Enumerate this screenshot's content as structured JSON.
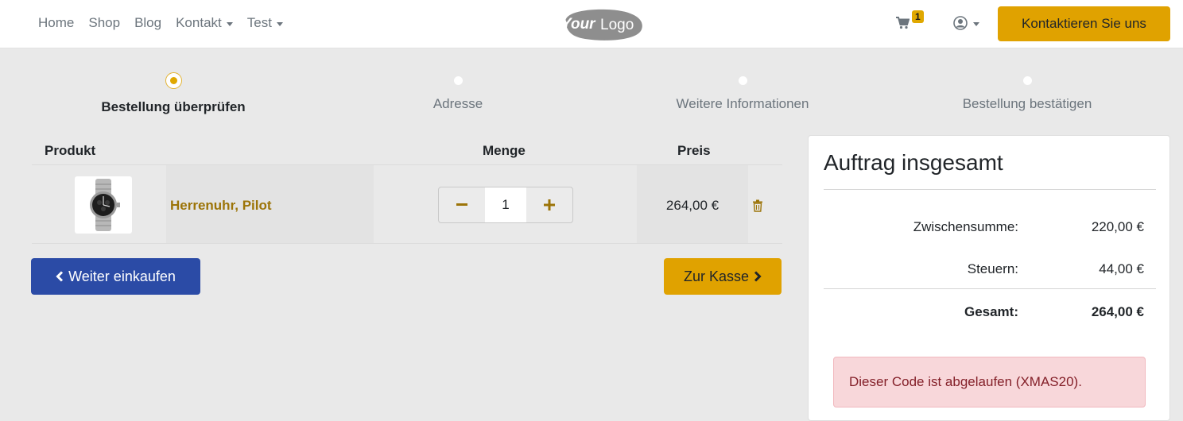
{
  "nav": {
    "links": [
      {
        "label": "Home"
      },
      {
        "label": "Shop"
      },
      {
        "label": "Blog"
      },
      {
        "label": "Kontakt"
      },
      {
        "label": "Test"
      }
    ],
    "logo_text_bold": "Your",
    "logo_text_light": "Logo",
    "cart_count": "1",
    "cta_label": "Kontaktieren Sie uns"
  },
  "steps": [
    {
      "label": "Bestellung überprüfen",
      "active": true
    },
    {
      "label": "Adresse",
      "active": false
    },
    {
      "label": "Weitere Informationen",
      "active": false
    },
    {
      "label": "Bestellung bestätigen",
      "active": false
    }
  ],
  "table": {
    "headers": {
      "product": "Produkt",
      "quantity": "Menge",
      "price": "Preis"
    },
    "rows": [
      {
        "name": "Herrenuhr, Pilot",
        "quantity": "1",
        "price": "264,00 €"
      }
    ]
  },
  "actions": {
    "continue_label": "Weiter einkaufen",
    "checkout_label": "Zur Kasse"
  },
  "summary": {
    "title": "Auftrag insgesamt",
    "subtotal_label": "Zwischensumme:",
    "subtotal_value": "220,00 €",
    "tax_label": "Steuern:",
    "tax_value": "44,00 €",
    "total_label": "Gesamt:",
    "total_value": "264,00 €",
    "alert": "Dieser Code ist abgelaufen (XMAS20)."
  },
  "colors": {
    "accent": "#e0a200",
    "primary_button": "#2b4ba6",
    "product_link": "#9c7408",
    "alert_bg": "#f8d7da",
    "alert_text": "#842029"
  }
}
